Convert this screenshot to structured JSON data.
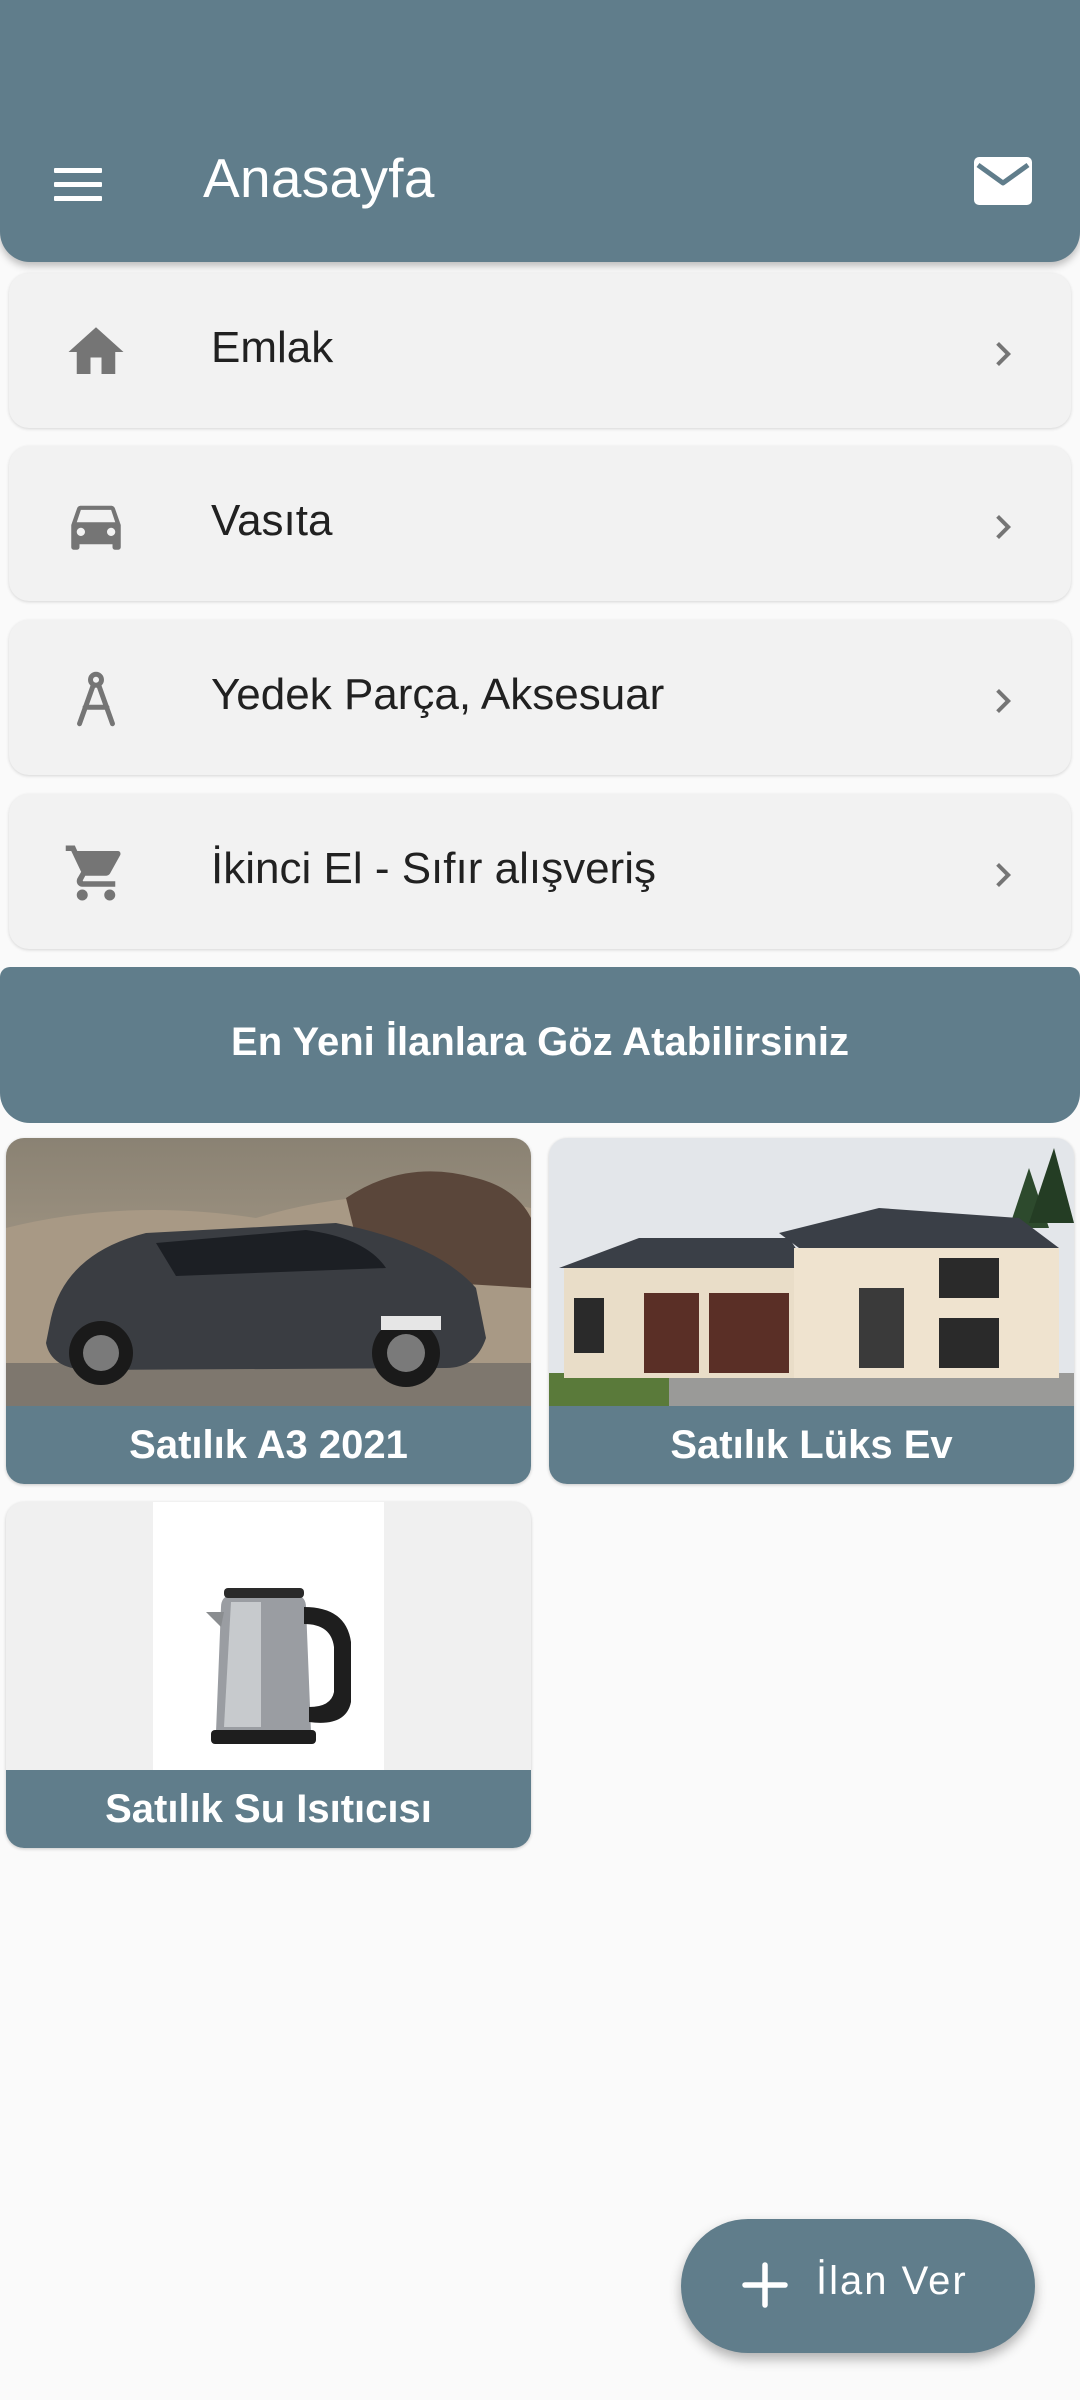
{
  "appbar": {
    "title": "Anasayfa",
    "menu_icon": "menu-icon",
    "mail_icon": "mail-icon"
  },
  "categories": [
    {
      "label": "Emlak",
      "icon": "home-icon"
    },
    {
      "label": "Vasıta",
      "icon": "car-icon"
    },
    {
      "label": "Yedek Parça, Aksesuar",
      "icon": "compass-icon"
    },
    {
      "label": "İkinci El - Sıfır alışveriş",
      "icon": "cart-icon"
    }
  ],
  "banner": {
    "text": "En Yeni İlanlara Göz Atabilirsiniz"
  },
  "listings": [
    {
      "title": "Satılık A3 2021",
      "image": "car-photo"
    },
    {
      "title": "Satılık Lüks Ev",
      "image": "house-photo"
    },
    {
      "title": "Satılık Su Isıtıcısı",
      "image": "kettle-photo"
    }
  ],
  "fab": {
    "label": "İlan Ver",
    "icon": "plus-icon"
  },
  "colors": {
    "primary": "#607d8b",
    "card_bg": "#f2f2f2",
    "icon_grey": "#757575"
  }
}
